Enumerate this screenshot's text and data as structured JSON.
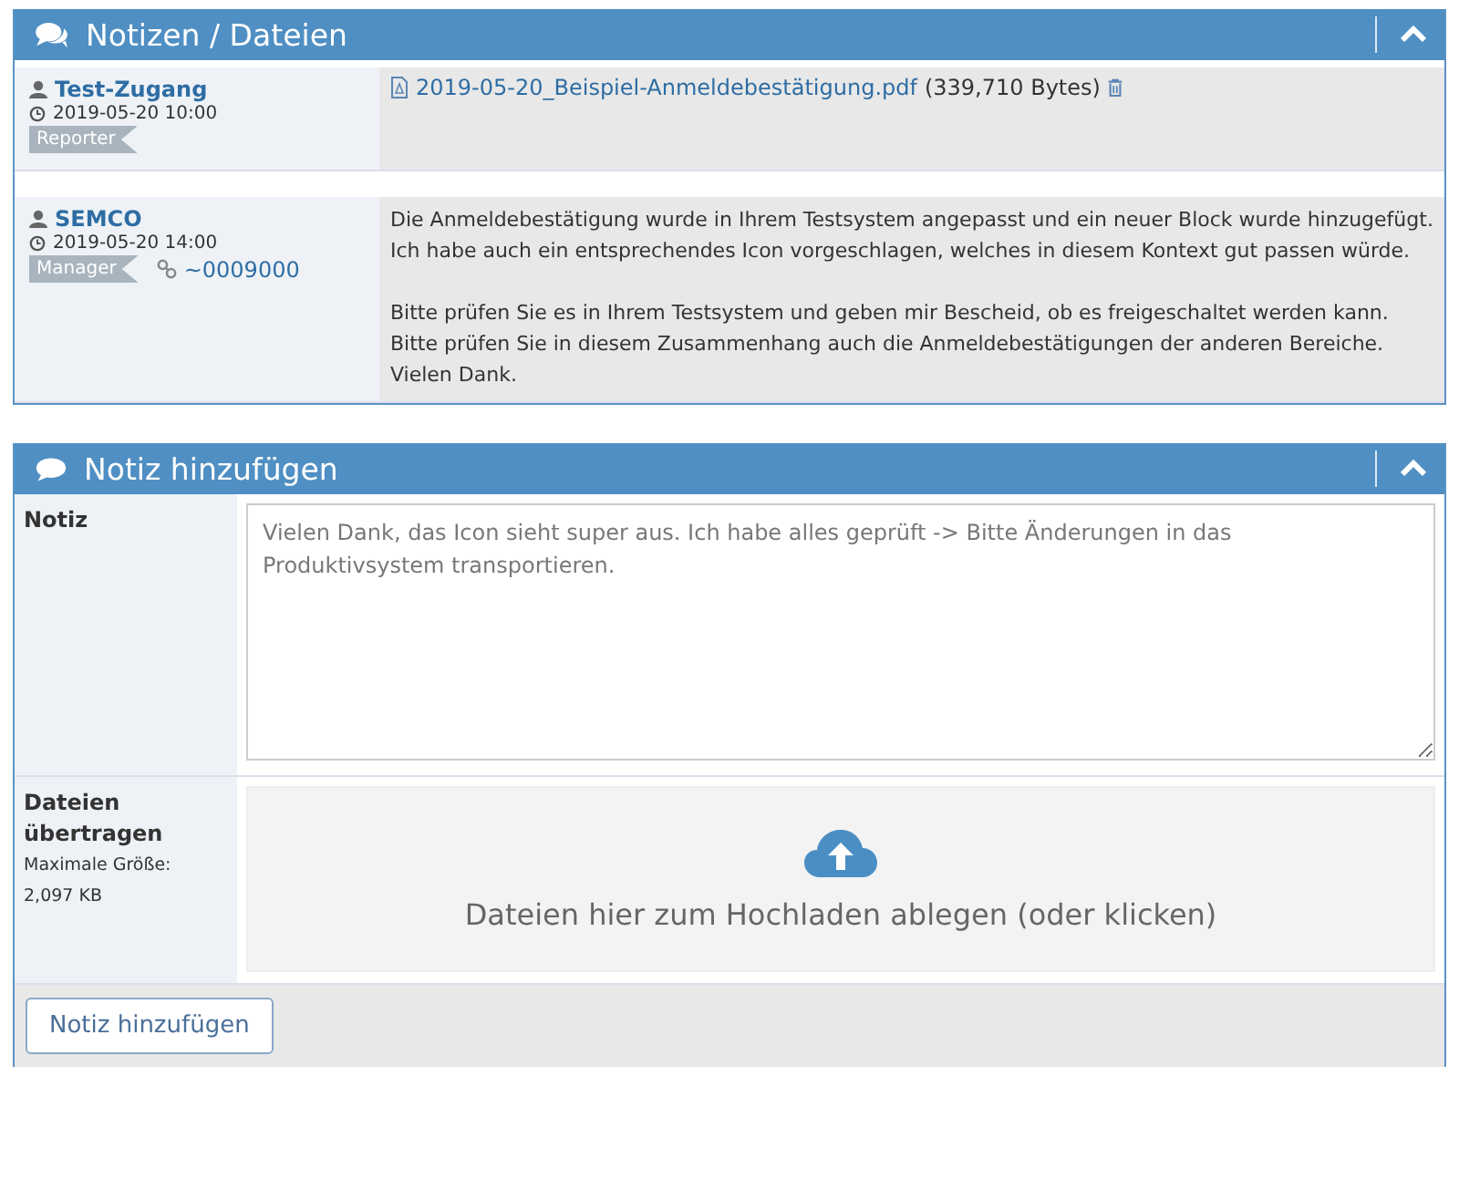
{
  "notes_panel": {
    "title": "Notizen / Dateien",
    "expanded": true,
    "notes": [
      {
        "author": "Test-Zugang",
        "time": "2019-05-20 10:00",
        "role": "Reporter",
        "kind": "file",
        "file": {
          "name": "2019-05-20_Beispiel-Anmeldebestätigung.pdf",
          "size": "(339,710 Bytes)"
        }
      },
      {
        "author": "SEMCO",
        "time": "2019-05-20 14:00",
        "role": "Manager",
        "link": "~0009000",
        "kind": "text",
        "paragraphs": [
          "Die Anmeldebestätigung wurde in Ihrem Testsystem angepasst und ein neuer Block wurde hinzugefügt. Ich habe auch ein entsprechendes Icon vorgeschlagen, welches in diesem Kontext gut passen würde.",
          "Bitte prüfen Sie es in Ihrem Testsystem und geben mir Bescheid, ob es freigeschaltet werden kann. Bitte prüfen Sie in diesem Zusammenhang auch die Anmeldebestätigungen der anderen Bereiche. Vielen Dank."
        ]
      }
    ]
  },
  "add_panel": {
    "title": "Notiz hinzufügen",
    "expanded": true,
    "note_label": "Notiz",
    "note_value": "Vielen Dank, das Icon sieht super aus. Ich habe alles geprüft -> Bitte Änderungen in das Produktivsystem transportieren.",
    "files_label": "Dateien übertragen",
    "max_size_label": "Maximale Größe:",
    "max_size": "2,097 KB",
    "dropzone_text": "Dateien hier zum Hochladen ablegen (oder klicken)",
    "submit": "Notiz hinzufügen"
  }
}
